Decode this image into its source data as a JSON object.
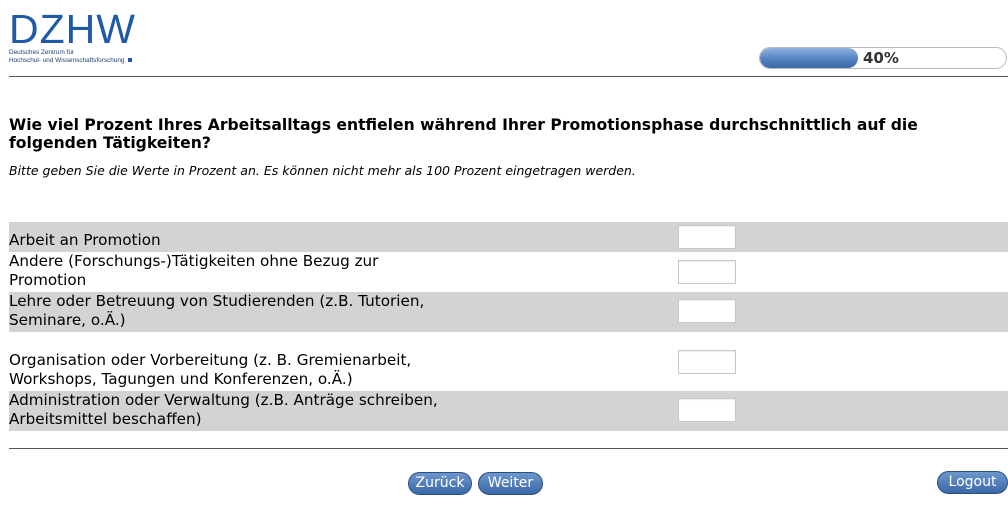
{
  "logo": {
    "mark": "DZHW",
    "subline1": "Deutsches Zentrum für",
    "subline2": "Hochschul- und Wissenschaftsforschung"
  },
  "progress": {
    "percent": 40,
    "label": "40%"
  },
  "question": {
    "text": "Wie viel Prozent Ihres Arbeitsalltags entfielen während Ihrer Promotionsphase durchschnittlich auf die folgenden Tätigkeiten?",
    "instruction": "Bitte geben Sie die Werte in Prozent an. Es können nicht mehr als 100 Prozent eingetragen werden."
  },
  "items": [
    {
      "label": "Arbeit an Promotion",
      "value": ""
    },
    {
      "label": "Andere (Forschungs-)Tätigkeiten ohne Bezug zur Promotion",
      "value": ""
    },
    {
      "label": "Lehre oder Betreuung von Studierenden (z.B. Tutorien, Seminare, o.Ä.)",
      "value": ""
    },
    {
      "label": "Organisation oder Vorbereitung (z. B. Gremienarbeit, Workshops, Tagungen und Konferenzen, o.Ä.)",
      "value": ""
    },
    {
      "label": "Administration oder Verwaltung (z.B. Anträge schreiben, Arbeitsmittel beschaffen)",
      "value": ""
    }
  ],
  "buttons": {
    "back": "Zurück",
    "next": "Weiter",
    "logout": "Logout"
  },
  "colors": {
    "brand": "#1f5aa8",
    "row_shade": "#d3d3d3",
    "button": "#3a69a8"
  }
}
